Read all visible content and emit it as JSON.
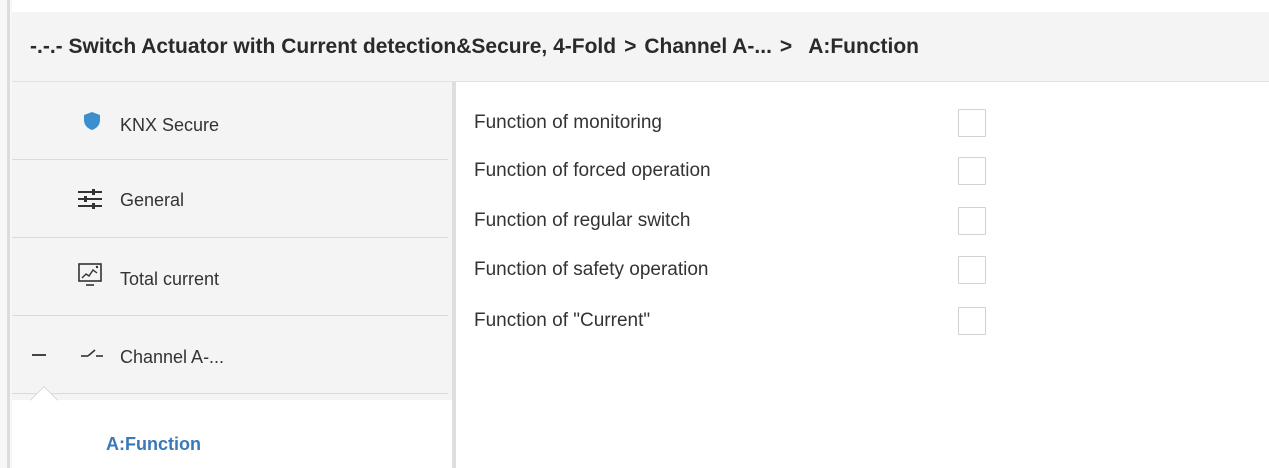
{
  "header": {
    "crumb_device": "-.-.- Switch Actuator with Current detection&Secure, 4-Fold",
    "separator": ">",
    "crumb_channel": "Channel A-...",
    "current": "A:Function"
  },
  "sidebar": {
    "items": [
      {
        "label": "KNX Secure",
        "icon": "shield-icon"
      },
      {
        "label": "General",
        "icon": "sliders-icon"
      },
      {
        "label": "Total current",
        "icon": "chart-icon"
      },
      {
        "label": "Channel A-...",
        "icon": "switch-icon",
        "expanded": true
      }
    ],
    "selected": {
      "label": "A:Function"
    }
  },
  "params": [
    {
      "label": "Function of monitoring",
      "checked": false
    },
    {
      "label": "Function of forced operation",
      "checked": false
    },
    {
      "label": "Function of regular switch",
      "checked": false
    },
    {
      "label": "Function of safety operation",
      "checked": false
    },
    {
      "label": "Function of \"Current\"",
      "checked": false
    }
  ],
  "colors": {
    "shield": "#3b8fcf",
    "selected_text": "#3a78b8",
    "sidebar_bg": "#f4f4f4"
  }
}
